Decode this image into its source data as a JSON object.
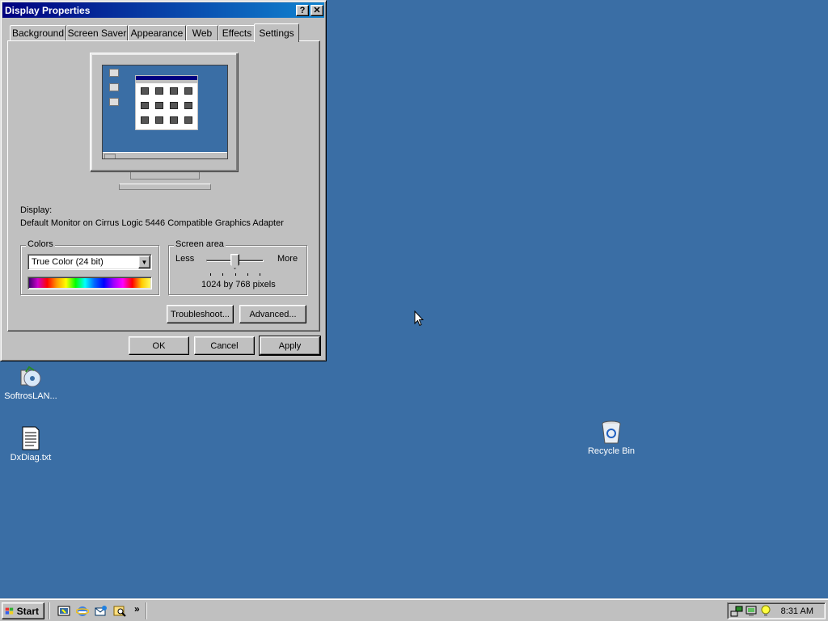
{
  "window": {
    "title": "Display Properties",
    "help_label": "?",
    "close_label": "✕"
  },
  "tabs": [
    {
      "label": "Background"
    },
    {
      "label": "Screen Saver"
    },
    {
      "label": "Appearance"
    },
    {
      "label": "Web"
    },
    {
      "label": "Effects"
    },
    {
      "label": "Settings"
    }
  ],
  "active_tab": "Settings",
  "settings": {
    "display_label": "Display:",
    "display_value": "Default Monitor on Cirrus Logic 5446 Compatible Graphics Adapter",
    "colors": {
      "group_title": "Colors",
      "selected": "True Color (24 bit)"
    },
    "screen_area": {
      "group_title": "Screen area",
      "less_label": "Less",
      "more_label": "More",
      "resolution_text": "1024 by 768 pixels",
      "slider_position": 0.5
    },
    "troubleshoot_label": "Troubleshoot...",
    "advanced_label": "Advanced..."
  },
  "dialog_buttons": {
    "ok": "OK",
    "cancel": "Cancel",
    "apply": "Apply"
  },
  "desktop_icons": [
    {
      "label": "SoftrosLAN...",
      "icon": "network-cd-icon"
    },
    {
      "label": "DxDiag.txt",
      "icon": "text-file-icon"
    },
    {
      "label": "Recycle Bin",
      "icon": "recycle-bin-icon"
    }
  ],
  "taskbar": {
    "start_label": "Start",
    "quick_launch": [
      "show-desktop-icon",
      "internet-explorer-icon",
      "outlook-express-icon",
      "search-icon"
    ],
    "chevron": "»",
    "clock": "8:31 AM"
  },
  "colors": {
    "desktop": "#3a6ea5",
    "title_bar": "#000080",
    "face": "#c0c0c0"
  }
}
